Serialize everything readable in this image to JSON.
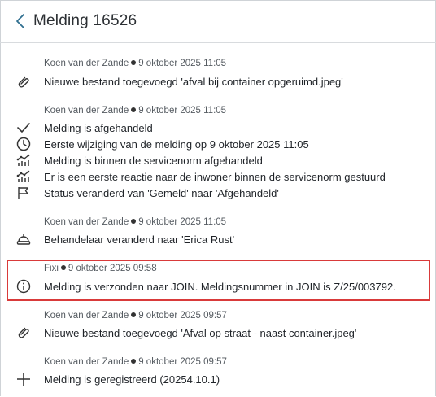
{
  "header": {
    "title": "Melding 16526"
  },
  "entries": [
    {
      "author": "Koen van der Zande",
      "timestamp": "9 oktober 2025 11:05",
      "lines": [
        "Nieuwe bestand toegevoegd 'afval bij container opgeruimd.jpeg'"
      ]
    },
    {
      "author": "Koen van der Zande",
      "timestamp": "9 oktober 2025 11:05",
      "lines": [
        "Melding is afgehandeld",
        "Eerste wijziging van de melding op 9 oktober 2025 11:05",
        "Melding is binnen de servicenorm afgehandeld",
        "Er is een eerste reactie naar de inwoner binnen de servicenorm gestuurd",
        "Status veranderd van 'Gemeld' naar 'Afgehandeld'"
      ]
    },
    {
      "author": "Koen van der Zande",
      "timestamp": "9 oktober 2025 11:05",
      "lines": [
        "Behandelaar veranderd naar 'Erica Rust'"
      ]
    },
    {
      "author": "Fixi",
      "timestamp": "9 oktober 2025 09:58",
      "lines": [
        "Melding is verzonden naar JOIN. Meldingsnummer in JOIN is Z/25/003792."
      ]
    },
    {
      "author": "Koen van der Zande",
      "timestamp": "9 oktober 2025 09:57",
      "lines": [
        "Nieuwe bestand toegevoegd 'Afval op straat - naast container.jpeg'"
      ]
    },
    {
      "author": "Koen van der Zande",
      "timestamp": "9 oktober 2025 09:57",
      "lines": [
        "Melding is geregistreerd (20254.10.1)"
      ]
    }
  ],
  "icons": {
    "e0": "paperclip-icon",
    "e1l0": "checkmark-icon",
    "e1l1": "clock-icon",
    "e1l2": "chart-icon",
    "e1l3": "chart-icon",
    "e1l4": "flag-icon",
    "e2": "helmet-icon",
    "e3": "info-icon",
    "e4": "paperclip-icon",
    "e5": "plus-icon"
  },
  "colors": {
    "accent": "#2f6f8f",
    "highlight": "#d93a3a"
  }
}
